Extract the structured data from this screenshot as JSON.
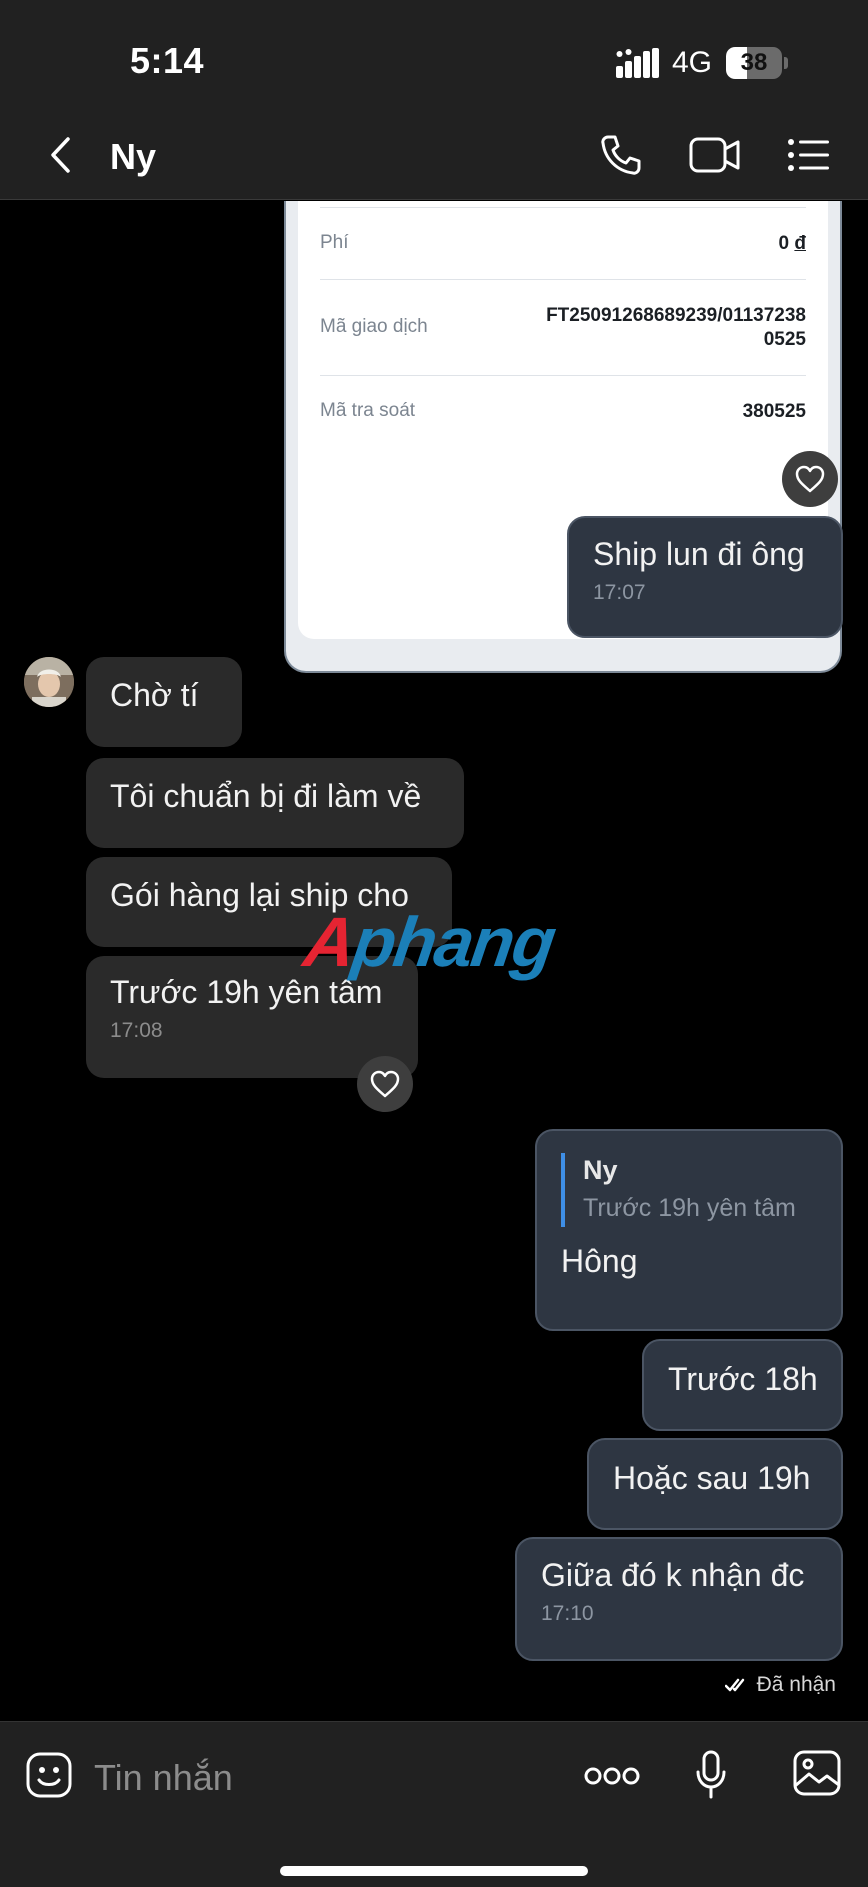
{
  "status_bar": {
    "time": "5:14",
    "network": "4G",
    "battery": "38",
    "battery_level": 0.38
  },
  "header": {
    "title": "Ny",
    "icons": [
      "back-chevron-icon",
      "phone-icon",
      "video-call-icon",
      "menu-list-icon"
    ]
  },
  "transfer_card": {
    "rows": [
      {
        "label": "Phí",
        "value": "0",
        "currency": "đ"
      },
      {
        "label": "Mã giao dịch",
        "value_line1": "FT25091268689239/01137238",
        "value_line2": "0525"
      },
      {
        "label": "Mã tra soát",
        "value": "380525"
      }
    ]
  },
  "messages": [
    {
      "id": "m1",
      "direction": "sent",
      "text": "Ship lun đi ông",
      "time": "17:07"
    },
    {
      "id": "m2",
      "direction": "received",
      "text": "Chờ tí"
    },
    {
      "id": "m3",
      "direction": "received",
      "text": "Tôi chuẩn bị đi làm về"
    },
    {
      "id": "m4",
      "direction": "received",
      "text": "Gói hàng lại ship cho"
    },
    {
      "id": "m5",
      "direction": "received",
      "text": "Trước 19h yên tâm",
      "time": "17:08"
    },
    {
      "id": "m6",
      "direction": "sent",
      "reply_to": {
        "name": "Ny",
        "text": "Trước 19h yên tâm"
      },
      "text": "Hông"
    },
    {
      "id": "m7",
      "direction": "sent",
      "text": "Trước 18h"
    },
    {
      "id": "m8",
      "direction": "sent",
      "text": "Hoặc sau 19h"
    },
    {
      "id": "m9",
      "direction": "sent",
      "text": "Giữa đó k nhận đc",
      "time": "17:10"
    }
  ],
  "receipt_status": "Đã nhận",
  "watermark": {
    "first": "A",
    "rest": "phang"
  },
  "input": {
    "placeholder": "Tin nhắn",
    "icons": [
      "sticker-icon",
      "more-options-icon",
      "microphone-icon",
      "image-picker-icon"
    ]
  },
  "colors": {
    "sent_bubble": "#2e3642",
    "received_bubble": "#2a2a2a",
    "bar_background": "#212121",
    "reply_accent": "#3f8fe6",
    "watermark_red": "#e62432",
    "watermark_blue": "#1b7fb8"
  }
}
